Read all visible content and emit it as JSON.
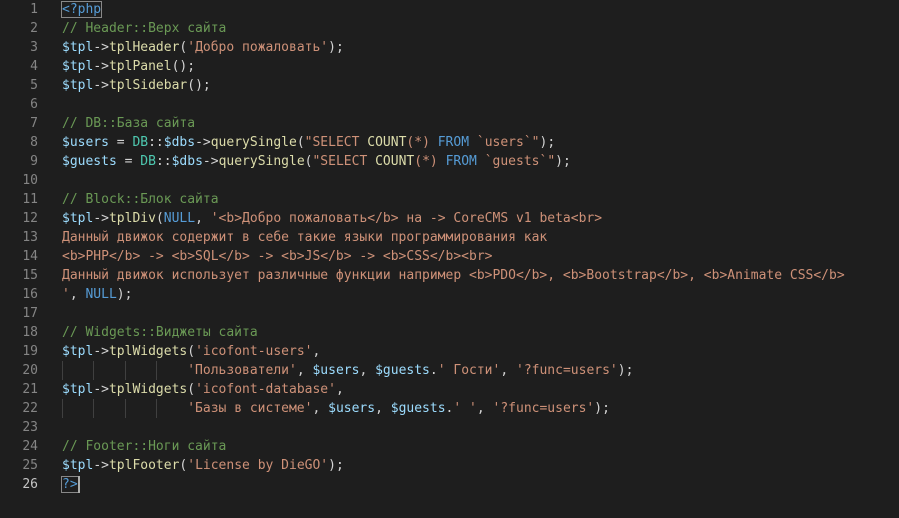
{
  "editor": {
    "language": "php",
    "active_line": 26,
    "colors": {
      "background": "#1e1e1e",
      "line_number": "#858585",
      "comment": "#6a9955",
      "string": "#ce9178",
      "variable": "#9cdcfe",
      "function": "#dcdcaa",
      "keyword": "#569cd6",
      "class": "#4ec9b0",
      "text": "#d4d4d4"
    },
    "lines": [
      {
        "n": "1",
        "tokens": [
          {
            "t": "tag",
            "v": "<?php"
          }
        ]
      },
      {
        "n": "2",
        "tokens": [
          {
            "t": "com",
            "v": "// Header::Верх сайта"
          }
        ]
      },
      {
        "n": "3",
        "tokens": [
          {
            "t": "var",
            "v": "$tpl"
          },
          {
            "t": "op",
            "v": "->"
          },
          {
            "t": "fn",
            "v": "tplHeader"
          },
          {
            "t": "op",
            "v": "("
          },
          {
            "t": "str",
            "v": "'Добро пожаловать'"
          },
          {
            "t": "op",
            "v": ");"
          }
        ]
      },
      {
        "n": "4",
        "tokens": [
          {
            "t": "var",
            "v": "$tpl"
          },
          {
            "t": "op",
            "v": "->"
          },
          {
            "t": "fn",
            "v": "tplPanel"
          },
          {
            "t": "op",
            "v": "();"
          }
        ]
      },
      {
        "n": "5",
        "tokens": [
          {
            "t": "var",
            "v": "$tpl"
          },
          {
            "t": "op",
            "v": "->"
          },
          {
            "t": "fn",
            "v": "tplSidebar"
          },
          {
            "t": "op",
            "v": "();"
          }
        ]
      },
      {
        "n": "6",
        "tokens": []
      },
      {
        "n": "7",
        "tokens": [
          {
            "t": "com",
            "v": "// DB::База сайта"
          }
        ]
      },
      {
        "n": "8",
        "tokens": [
          {
            "t": "var",
            "v": "$users"
          },
          {
            "t": "op",
            "v": " = "
          },
          {
            "t": "cls",
            "v": "DB"
          },
          {
            "t": "op",
            "v": "::"
          },
          {
            "t": "var",
            "v": "$dbs"
          },
          {
            "t": "op",
            "v": "->"
          },
          {
            "t": "fn",
            "v": "querySingle"
          },
          {
            "t": "op",
            "v": "("
          },
          {
            "t": "str",
            "v": "\"SELECT "
          },
          {
            "t": "fn",
            "v": "COUNT"
          },
          {
            "t": "str",
            "v": "(*) "
          },
          {
            "t": "kw",
            "v": "FROM"
          },
          {
            "t": "str",
            "v": " `users`\""
          },
          {
            "t": "op",
            "v": ");"
          }
        ]
      },
      {
        "n": "9",
        "tokens": [
          {
            "t": "var",
            "v": "$guests"
          },
          {
            "t": "op",
            "v": " = "
          },
          {
            "t": "cls",
            "v": "DB"
          },
          {
            "t": "op",
            "v": "::"
          },
          {
            "t": "var",
            "v": "$dbs"
          },
          {
            "t": "op",
            "v": "->"
          },
          {
            "t": "fn",
            "v": "querySingle"
          },
          {
            "t": "op",
            "v": "("
          },
          {
            "t": "str",
            "v": "\"SELECT "
          },
          {
            "t": "fn",
            "v": "COUNT"
          },
          {
            "t": "str",
            "v": "(*) "
          },
          {
            "t": "kw",
            "v": "FROM"
          },
          {
            "t": "str",
            "v": " `guests`\""
          },
          {
            "t": "op",
            "v": ");"
          }
        ]
      },
      {
        "n": "10",
        "tokens": []
      },
      {
        "n": "11",
        "tokens": [
          {
            "t": "com",
            "v": "// Block::Блок сайта"
          }
        ]
      },
      {
        "n": "12",
        "tokens": [
          {
            "t": "var",
            "v": "$tpl"
          },
          {
            "t": "op",
            "v": "->"
          },
          {
            "t": "fn",
            "v": "tplDiv"
          },
          {
            "t": "op",
            "v": "("
          },
          {
            "t": "kw",
            "v": "NULL"
          },
          {
            "t": "op",
            "v": ", "
          },
          {
            "t": "str",
            "v": "'<b>Добро пожаловать</b> на -> CoreCMS v1 beta<br>"
          }
        ]
      },
      {
        "n": "13",
        "tokens": [
          {
            "t": "str",
            "v": "Данный движок содержит в себе такие языки программирования как"
          }
        ]
      },
      {
        "n": "14",
        "tokens": [
          {
            "t": "str",
            "v": "<b>PHP</b> -> <b>SQL</b> -> <b>JS</b> -> <b>CSS</b><br>"
          }
        ]
      },
      {
        "n": "15",
        "tokens": [
          {
            "t": "str",
            "v": "Данный движок использует различные функции например <b>PDO</b>, <b>Bootstrap</b>, <b>Animate CSS</b>"
          }
        ]
      },
      {
        "n": "16",
        "tokens": [
          {
            "t": "str",
            "v": "'"
          },
          {
            "t": "op",
            "v": ", "
          },
          {
            "t": "kw",
            "v": "NULL"
          },
          {
            "t": "op",
            "v": ");"
          }
        ]
      },
      {
        "n": "17",
        "tokens": []
      },
      {
        "n": "18",
        "tokens": [
          {
            "t": "com",
            "v": "// Widgets::Виджеты сайта"
          }
        ]
      },
      {
        "n": "19",
        "tokens": [
          {
            "t": "var",
            "v": "$tpl"
          },
          {
            "t": "op",
            "v": "->"
          },
          {
            "t": "fn",
            "v": "tplWidgets"
          },
          {
            "t": "op",
            "v": "("
          },
          {
            "t": "str",
            "v": "'icofont-users'"
          },
          {
            "t": "op",
            "v": ","
          }
        ]
      },
      {
        "n": "20",
        "indent": 4,
        "tokens": [
          {
            "t": "str",
            "v": "'Пользователи'"
          },
          {
            "t": "op",
            "v": ", "
          },
          {
            "t": "var",
            "v": "$users"
          },
          {
            "t": "op",
            "v": ", "
          },
          {
            "t": "var",
            "v": "$guests"
          },
          {
            "t": "op",
            "v": "."
          },
          {
            "t": "str",
            "v": "' Гости'"
          },
          {
            "t": "op",
            "v": ", "
          },
          {
            "t": "str",
            "v": "'?func=users'"
          },
          {
            "t": "op",
            "v": ");"
          }
        ]
      },
      {
        "n": "21",
        "tokens": [
          {
            "t": "var",
            "v": "$tpl"
          },
          {
            "t": "op",
            "v": "->"
          },
          {
            "t": "fn",
            "v": "tplWidgets"
          },
          {
            "t": "op",
            "v": "("
          },
          {
            "t": "str",
            "v": "'icofont-database'"
          },
          {
            "t": "op",
            "v": ","
          }
        ]
      },
      {
        "n": "22",
        "indent": 4,
        "tokens": [
          {
            "t": "str",
            "v": "'Базы в системе'"
          },
          {
            "t": "op",
            "v": ", "
          },
          {
            "t": "var",
            "v": "$users"
          },
          {
            "t": "op",
            "v": ", "
          },
          {
            "t": "var",
            "v": "$guests"
          },
          {
            "t": "op",
            "v": "."
          },
          {
            "t": "str",
            "v": "' '"
          },
          {
            "t": "op",
            "v": ", "
          },
          {
            "t": "str",
            "v": "'?func=users'"
          },
          {
            "t": "op",
            "v": ");"
          }
        ]
      },
      {
        "n": "23",
        "tokens": []
      },
      {
        "n": "24",
        "tokens": [
          {
            "t": "com",
            "v": "// Footer::Ноги сайта"
          }
        ]
      },
      {
        "n": "25",
        "tokens": [
          {
            "t": "var",
            "v": "$tpl"
          },
          {
            "t": "op",
            "v": "->"
          },
          {
            "t": "fn",
            "v": "tplFooter"
          },
          {
            "t": "op",
            "v": "("
          },
          {
            "t": "str",
            "v": "'License by DieGO'"
          },
          {
            "t": "op",
            "v": ");"
          }
        ]
      },
      {
        "n": "26",
        "tokens": [
          {
            "t": "tag",
            "v": "?>"
          }
        ]
      }
    ]
  }
}
